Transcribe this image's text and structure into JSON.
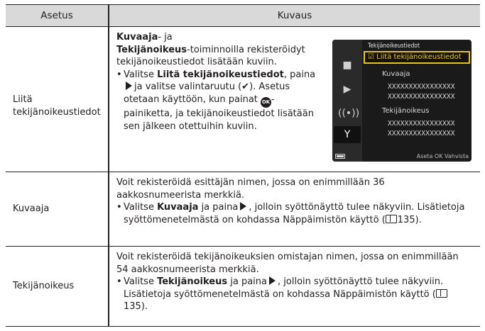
{
  "header": {
    "col_setting": "Asetus",
    "col_description": "Kuvaus"
  },
  "rows": [
    {
      "setting": "Liitä tekijänoikeustiedot",
      "intro_bold1": "Kuvaaja",
      "intro_mid": "- ja ",
      "intro_bold2": "Tekijänoikeus",
      "intro_rest": "-toiminnoilla rekisteröidyt tekijänoikeustiedot lisätään kuviin.",
      "bullet_pre": "Valitse ",
      "bullet_bold": "Liitä tekijänoikeustiedot",
      "bullet_mid": ", paina",
      "bullet_mid2": "ja valitse valintaruutu (",
      "bullet_check": "✔",
      "bullet_after": "). Asetus otetaan käyttöön, kun painat",
      "ok_label": "OK",
      "bullet_end": "-painiketta, ja tekijänoikeustiedot lisätään sen jälkeen otettuihin kuviin."
    },
    {
      "setting": "Kuvaaja",
      "line": "Voit rekisteröidä esittäjän nimen, jossa on enimmillään 36 aakkosnumeerista merkkiä.",
      "bullet_pre": "Valitse ",
      "bullet_bold": "Kuvaaja",
      "bullet_mid": " ja paina",
      "bullet_rest": ", jolloin syöttönäyttö tulee näkyviin. Lisätietoja syöttömenetelmästä on kohdassa Näppäimistön käyttö (",
      "page_ref": "135",
      "bullet_end": ")."
    },
    {
      "setting": "Tekijänoikeus",
      "line": "Voit rekisteröidä tekijänoikeuksien omistajan nimen, jossa on enimmillään 54 aakkosnumeerista merkkiä.",
      "bullet_pre": "Valitse ",
      "bullet_bold": "Tekijänoikeus",
      "bullet_mid": " ja paina",
      "bullet_rest": ", jolloin syöttönäyttö tulee näkyviin. Lisätietoja syöttömenetelmästä on kohdassa Näppäimistön käyttö (",
      "page_ref": "135",
      "bullet_end": ")."
    }
  ],
  "camera_screen": {
    "title": "Tekijänoikeustiedot",
    "selected_item": "☑ Liitä tekijänoikeustiedot",
    "label1": "Kuvaaja",
    "value1_line1": "XXXXXXXXXXXXXXXX",
    "value1_line2": "XXXXXXXXXXXXXXXX",
    "label2": "Tekijänoikeus",
    "value2_line1": "XXXXXXXXXXXXXXXX",
    "value2_line2": "XXXXXXXXXXXXXXXX",
    "footer": "Aseta  OK Vahvista",
    "icons": [
      "camera-icon",
      "movie-icon",
      "wireless-icon",
      "wrench-icon"
    ],
    "selection_color": "#f0c400"
  }
}
